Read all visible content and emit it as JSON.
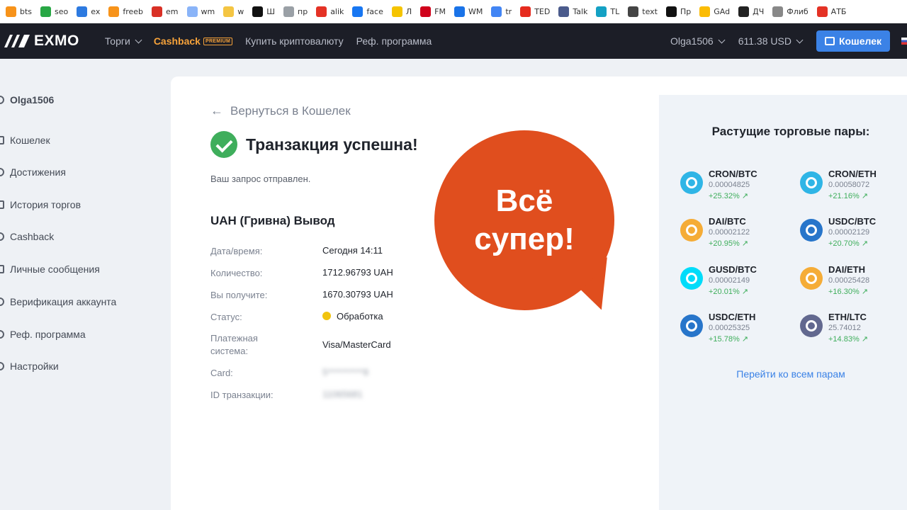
{
  "bookmarks": [
    {
      "label": "bts",
      "icon": "bitcoin-icon",
      "color": "#f7931a"
    },
    {
      "label": "seo",
      "icon": "target-icon",
      "color": "#28a745"
    },
    {
      "label": "ex",
      "icon": "exchange-icon",
      "color": "#2d7ae0"
    },
    {
      "label": "freeb",
      "icon": "bitcoin-icon",
      "color": "#f7931a"
    },
    {
      "label": "em",
      "icon": "gmail-icon",
      "color": "#d93025"
    },
    {
      "label": "wm",
      "icon": "w-icon",
      "color": "#8ab4f8"
    },
    {
      "label": "w",
      "icon": "coin-icon",
      "color": "#f4c542"
    },
    {
      "label": "Ш",
      "icon": "s-icon",
      "color": "#111111"
    },
    {
      "label": "пр",
      "icon": "document-icon",
      "color": "#9aa0a6"
    },
    {
      "label": "alik",
      "icon": "aliexpress-icon",
      "color": "#e43225"
    },
    {
      "label": "face",
      "icon": "facebook-icon",
      "color": "#1877f2"
    },
    {
      "label": "Л",
      "icon": "lightning-icon",
      "color": "#f5c400"
    },
    {
      "label": "FM",
      "icon": "bird-icon",
      "color": "#d0021b"
    },
    {
      "label": "WM",
      "icon": "globe-icon",
      "color": "#1a73e8"
    },
    {
      "label": "tr",
      "icon": "translate-icon",
      "color": "#4285f4"
    },
    {
      "label": "TED",
      "icon": "ted-icon",
      "color": "#e62b1e"
    },
    {
      "label": "Talk",
      "icon": "talk-icon",
      "color": "#4b5b8c"
    },
    {
      "label": "TL",
      "icon": "tl-icon",
      "color": "#14a1c4"
    },
    {
      "label": "text",
      "icon": "swallow-icon",
      "color": "#444444"
    },
    {
      "label": "Пр",
      "icon": "24-icon",
      "color": "#111111"
    },
    {
      "label": "GAd",
      "icon": "google-ads-icon",
      "color": "#fbbc04"
    },
    {
      "label": "ДЧ",
      "icon": "shield-icon",
      "color": "#222222"
    },
    {
      "label": "Флиб",
      "icon": "book-icon",
      "color": "#888888"
    },
    {
      "label": "АТБ",
      "icon": "atb-icon",
      "color": "#e43225"
    }
  ],
  "topnav": {
    "logo": "EXMO",
    "items": [
      "Торги",
      "Cashback",
      "Купить криптовалюту",
      "Реф. программа"
    ],
    "premium_badge": "PREMIUM",
    "user": "Olga1506",
    "balance": "611.38 USD",
    "wallet_button": "Кошелек"
  },
  "sidebar": {
    "user": "Olga1506",
    "items": [
      "Кошелек",
      "Достижения",
      "История торгов",
      "Cashback",
      "Личные сообщения",
      "Верификация аккаунта",
      "Реф. программа",
      "Настройки"
    ]
  },
  "main": {
    "back_link": "Вернуться в Кошелек",
    "success_title": "Транзакция успешна!",
    "sent_text": "Ваш запрос отправлен.",
    "tx_title": "UAH (Гривна) Вывод",
    "rows": [
      {
        "label": "Дата/время:",
        "value": "Сегодня 14:11"
      },
      {
        "label": "Количество:",
        "value": "1712.96793 UAH"
      },
      {
        "label": "Вы получите:",
        "value": "1670.30793 UAH"
      },
      {
        "label": "Статус:",
        "value": "Обработка"
      },
      {
        "label": "Платежная система:",
        "value": "Visa/MasterCard"
      },
      {
        "label": "Card:",
        "value": "5**********8"
      },
      {
        "label": "ID транзакции:",
        "value": "11065681"
      }
    ],
    "bubble_line1": "Всё",
    "bubble_line2": "супер!"
  },
  "right_panel": {
    "title": "Растущие торговые пары:",
    "pairs": [
      {
        "name": "CRON/BTC",
        "price": "0.00004825",
        "change": "+25.32% ↗",
        "coin_color": "#2fb5e6"
      },
      {
        "name": "CRON/ETH",
        "price": "0.00058072",
        "change": "+21.16% ↗",
        "coin_color": "#2fb5e6"
      },
      {
        "name": "DAI/BTC",
        "price": "0.00002122",
        "change": "+20.95% ↗",
        "coin_color": "#f5ac37"
      },
      {
        "name": "USDC/BTC",
        "price": "0.00002129",
        "change": "+20.70% ↗",
        "coin_color": "#2775ca"
      },
      {
        "name": "GUSD/BTC",
        "price": "0.00002149",
        "change": "+20.01% ↗",
        "coin_color": "#00dcfa"
      },
      {
        "name": "DAI/ETH",
        "price": "0.00025428",
        "change": "+16.30% ↗",
        "coin_color": "#f5ac37"
      },
      {
        "name": "USDC/ETH",
        "price": "0.00025325",
        "change": "+15.78% ↗",
        "coin_color": "#2775ca"
      },
      {
        "name": "ETH/LTC",
        "price": "25.74012",
        "change": "+14.83% ↗",
        "coin_color": "#62688f"
      }
    ],
    "all_pairs_link": "Перейти ко всем парам"
  }
}
